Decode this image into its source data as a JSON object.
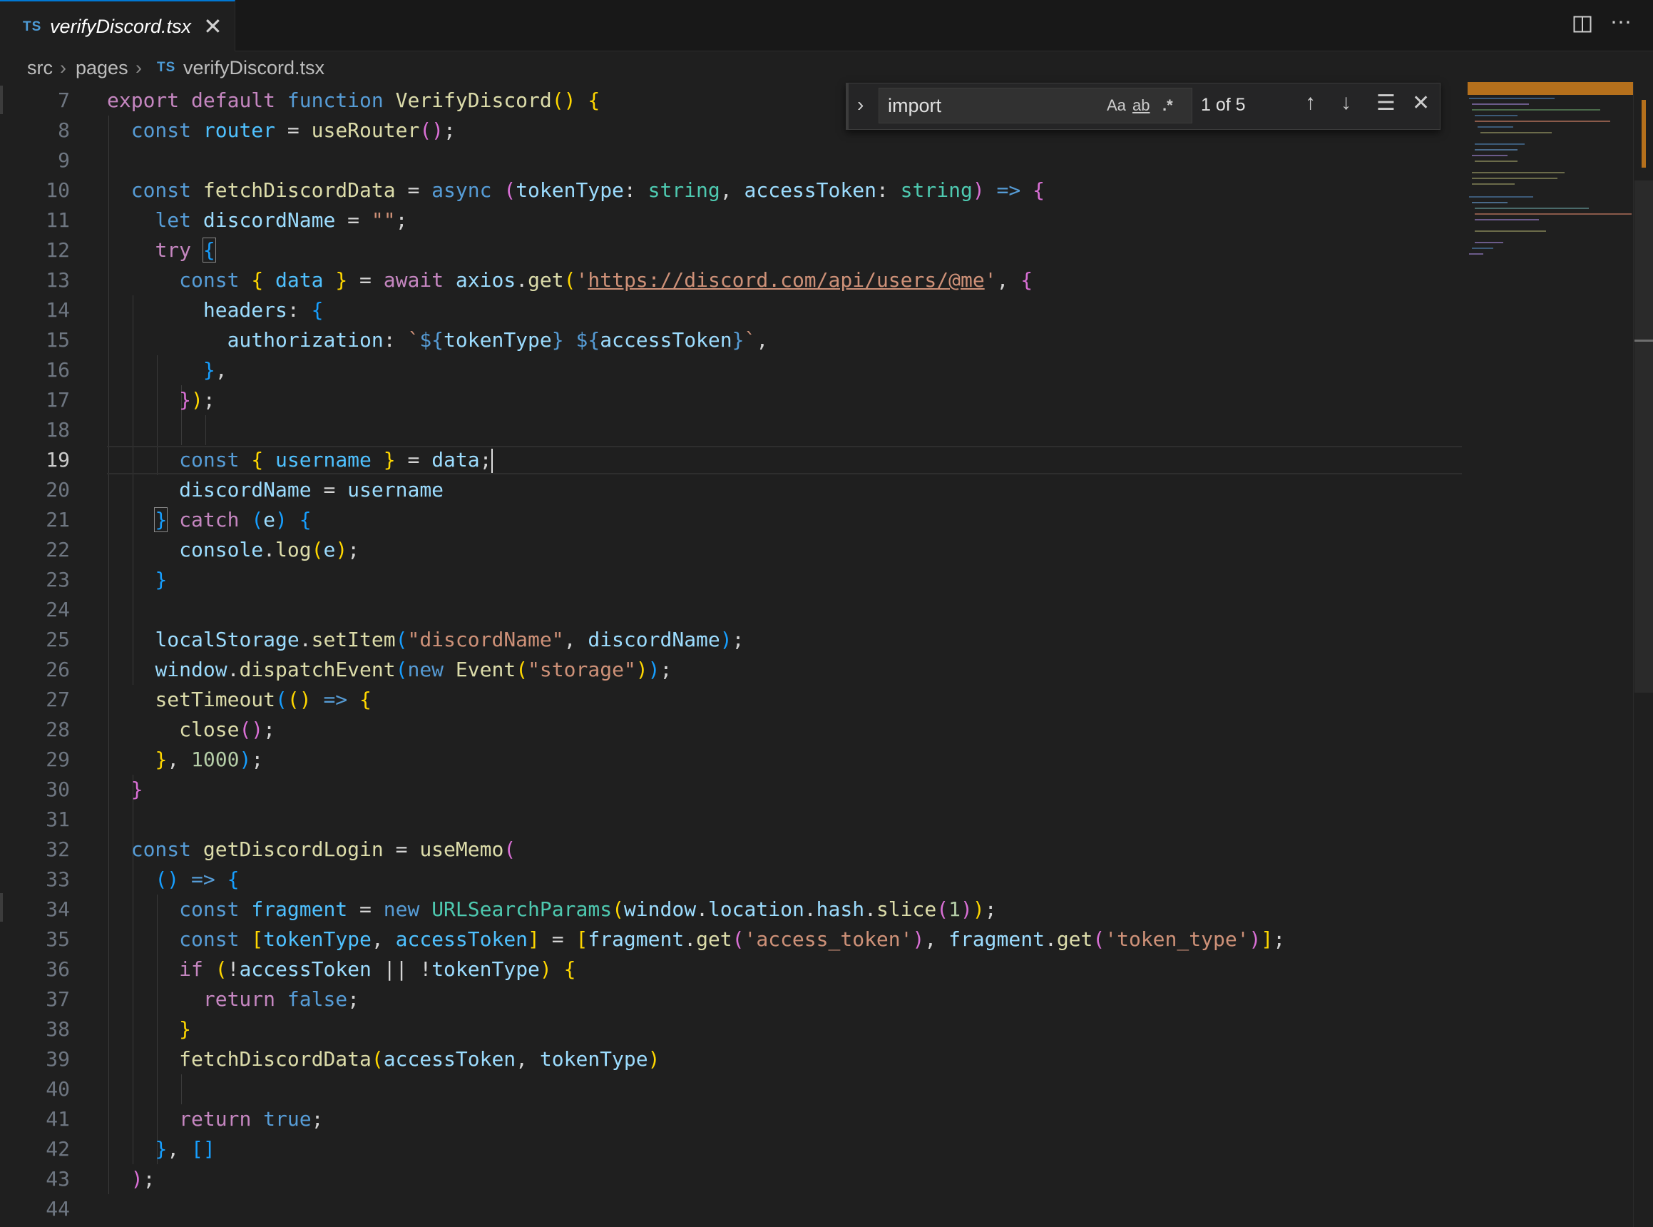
{
  "tab": {
    "lang_badge": "TS",
    "filename": "verifyDiscord.tsx",
    "close_glyph": "✕"
  },
  "toolbar": {
    "split_icon": "split-editor-icon",
    "more_glyph": "⋯"
  },
  "breadcrumb": {
    "items": [
      "src",
      "pages",
      "verifyDiscord.tsx"
    ],
    "separator": "›",
    "file_badge": "TS"
  },
  "find_widget": {
    "toggle_glyph": "›",
    "query": "import",
    "match_case_label": "Aa",
    "whole_word_label": "ab",
    "regex_label": ".*",
    "result_count": "1 of 5",
    "prev_glyph": "↑",
    "next_glyph": "↓",
    "selection_glyph": "☰",
    "close_glyph": "✕"
  },
  "editor": {
    "active_line": 19,
    "line_numbers": [
      "7",
      "8",
      "9",
      "10",
      "11",
      "12",
      "13",
      "14",
      "15",
      "16",
      "17",
      "18",
      "19",
      "20",
      "21",
      "22",
      "23",
      "24",
      "25",
      "26",
      "27",
      "28",
      "29",
      "30",
      "31",
      "32",
      "33",
      "34",
      "35",
      "36",
      "37",
      "38",
      "39",
      "40",
      "41",
      "42",
      "43",
      "44"
    ]
  },
  "colors": {
    "background": "#1f1f1f",
    "keyword": "#569cd6",
    "control": "#c586c0",
    "function": "#dcdcaa",
    "variable": "#9cdcfe",
    "type": "#4ec9b0",
    "string": "#ce9178",
    "number": "#b5cea8",
    "find_highlight": "#b5701c"
  }
}
